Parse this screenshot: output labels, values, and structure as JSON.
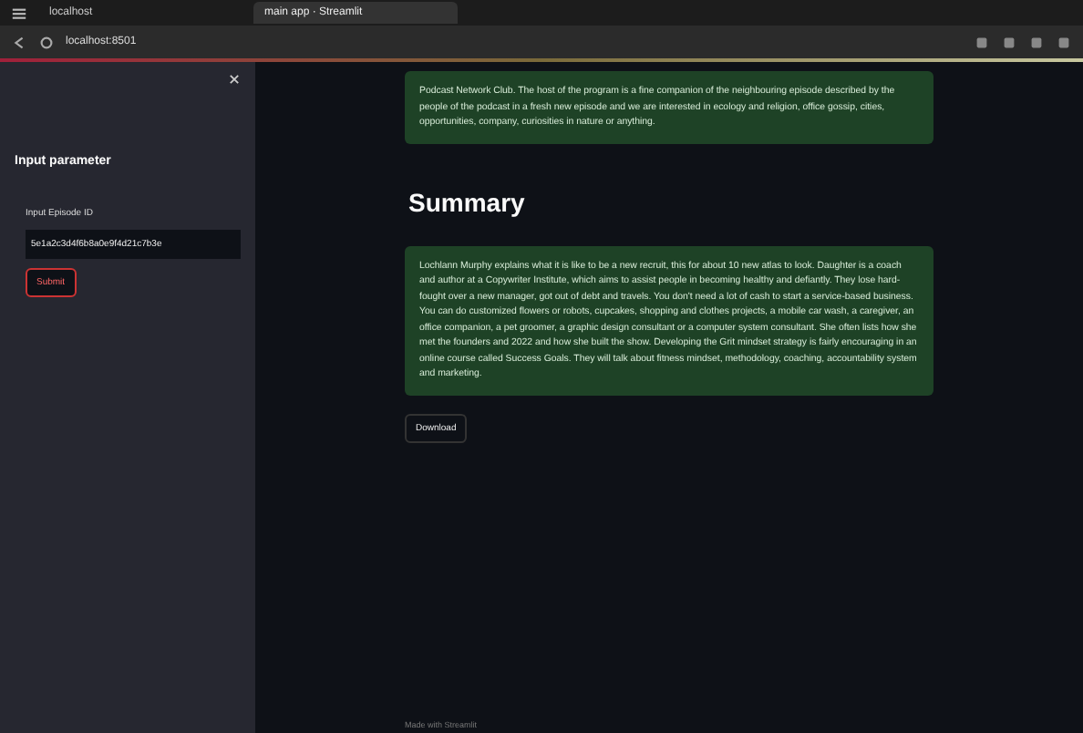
{
  "browser": {
    "tabs": [
      {
        "label": "localhost",
        "selected": false
      },
      {
        "label": "main app · Streamlit",
        "selected": true
      }
    ],
    "address": "localhost:8501"
  },
  "sidebar": {
    "heading": "Input parameter",
    "field_label": "Input Episode ID",
    "field_value": "5e1a2c3d4f6b8a0e9f4d21c7b3e",
    "button": "Submit"
  },
  "main": {
    "top_text": "Podcast Network Club. The host of the program is a fine companion of the neighbouring episode described by the people of the podcast in a fresh new episode and we are interested in ecology and religion, office gossip, cities, opportunities, company, curiosities in nature or anything.",
    "heading": "Summary",
    "summary": "Lochlann Murphy explains what it is like to be a new recruit, this for about 10 new atlas to look. Daughter is a coach and author at a Copywriter Institute, which aims to assist people in becoming healthy and defiantly. They lose hard-fought over a new manager, got out of debt and travels. You don't need a lot of cash to start a service-based business. You can do customized flowers or robots, cupcakes, shopping and clothes projects, a mobile car wash, a caregiver, an office companion, a pet groomer, a graphic design consultant or a computer system consultant. She often lists how she met the founders and 2022 and how she built the show. Developing the Grit mindset strategy is fairly encouraging in an online course called Success Goals. They will talk about fitness mindset, methodology, coaching, accountability system and marketing.",
    "download": "Download"
  },
  "footer": "Made with Streamlit"
}
